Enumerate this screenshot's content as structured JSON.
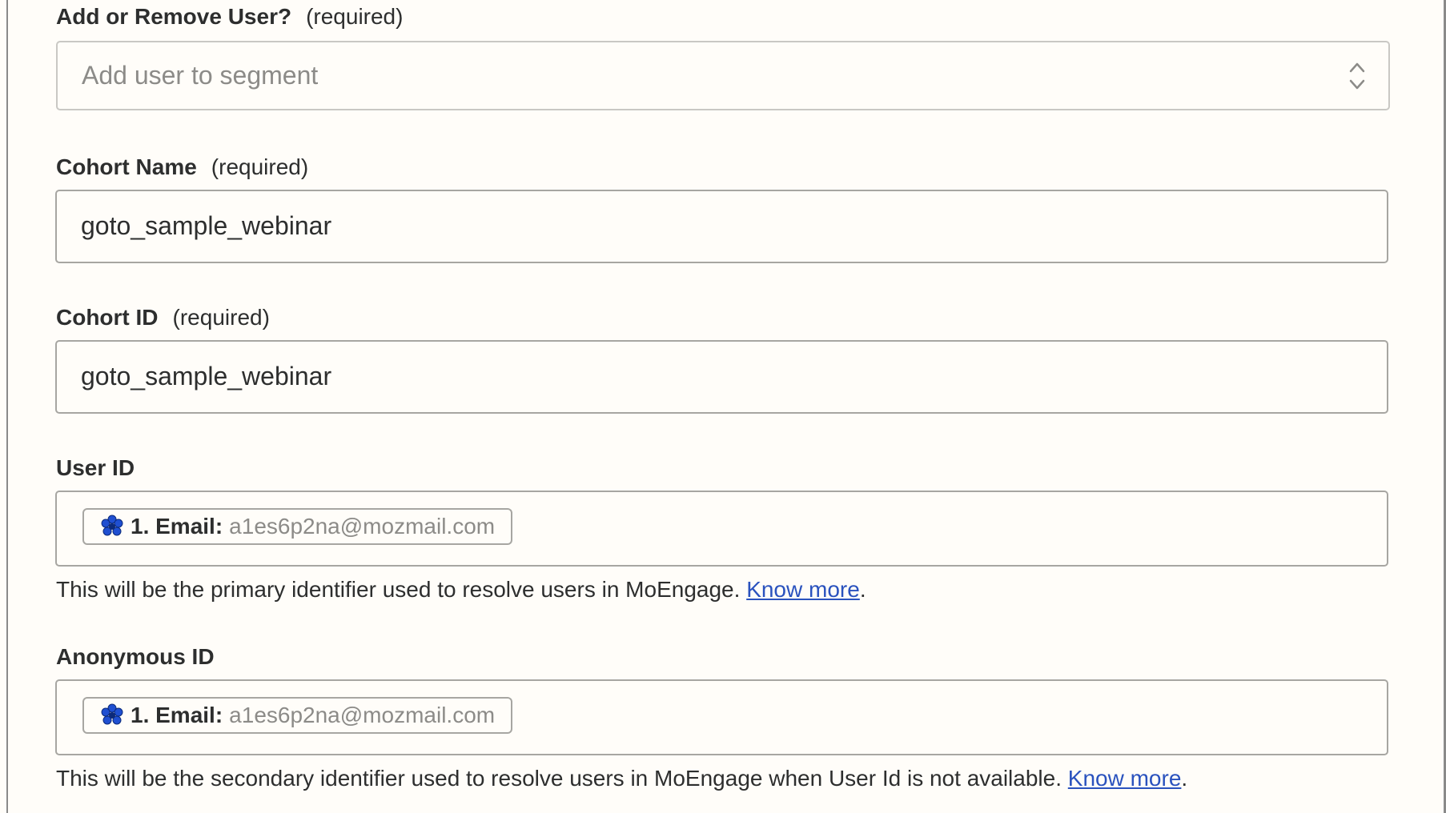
{
  "fields": {
    "add_remove": {
      "label": "Add or Remove User?",
      "required": "(required)",
      "placeholder": "Add user to segment"
    },
    "cohort_name": {
      "label": "Cohort Name",
      "required": "(required)",
      "value": "goto_sample_webinar"
    },
    "cohort_id": {
      "label": "Cohort ID",
      "required": "(required)",
      "value": "goto_sample_webinar"
    },
    "user_id": {
      "label": "User ID",
      "pill_key": "1. Email:",
      "pill_value": "a1es6p2na@mozmail.com",
      "help_text": "This will be the primary identifier used to resolve users in MoEngage. ",
      "link": "Know more",
      "period": "."
    },
    "anonymous_id": {
      "label": "Anonymous ID",
      "pill_key": "1. Email:",
      "pill_value": "a1es6p2na@mozmail.com",
      "help_text": "This will be the secondary identifier used to resolve users in MoEngage when User Id is not available. ",
      "link": "Know more",
      "period": "."
    }
  },
  "icons": {
    "select": "chevron-up-down-icon",
    "app": "flower-app-icon"
  },
  "colors": {
    "background": "#fffdf9",
    "link": "#2a52be",
    "border": "#a7a6a2",
    "placeholder": "#8c8b88",
    "app_icon": "#1f4fd1"
  }
}
